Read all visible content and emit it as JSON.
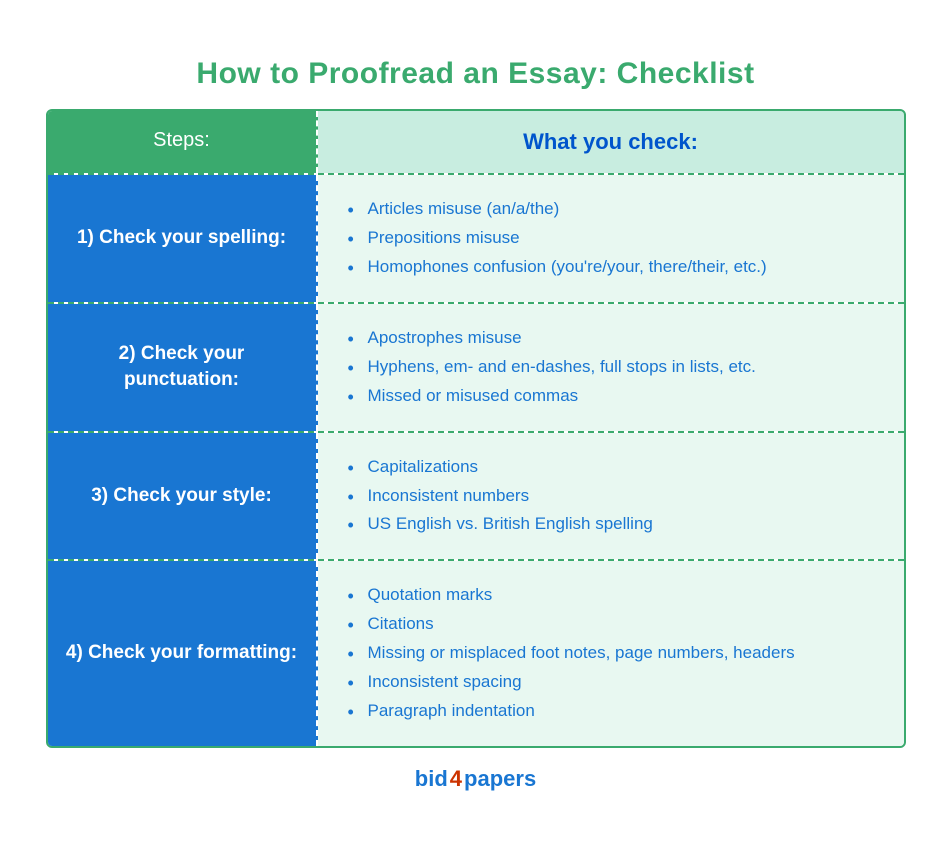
{
  "title": "How to Proofread an Essay: Checklist",
  "header": {
    "steps_label": "Steps:",
    "check_label": "What you check:"
  },
  "rows": [
    {
      "step_number": "1)",
      "step_label": "Check your spelling:",
      "items": [
        "Articles misuse (an/a/the)",
        "Prepositions misuse",
        "Homophones confusion (you're/your, there/their, etc.)"
      ]
    },
    {
      "step_number": "2)",
      "step_label": "Check your punctuation:",
      "items": [
        "Apostrophes misuse",
        "Hyphens, em- and en-dashes, full stops in lists, etc.",
        "Missed or misused commas"
      ]
    },
    {
      "step_number": "3)",
      "step_label": "Check your style:",
      "items": [
        "Capitalizations",
        "Inconsistent numbers",
        "US English vs. British English spelling"
      ]
    },
    {
      "step_number": "4)",
      "step_label": "Check your formatting:",
      "items": [
        "Quotation marks",
        "Citations",
        "Missing or misplaced foot notes, page numbers, headers",
        "Inconsistent spacing",
        "Paragraph indentation"
      ]
    }
  ],
  "footer": {
    "bid": "bid",
    "four": "4",
    "papers": "papers",
    "full": "bid4papers"
  }
}
